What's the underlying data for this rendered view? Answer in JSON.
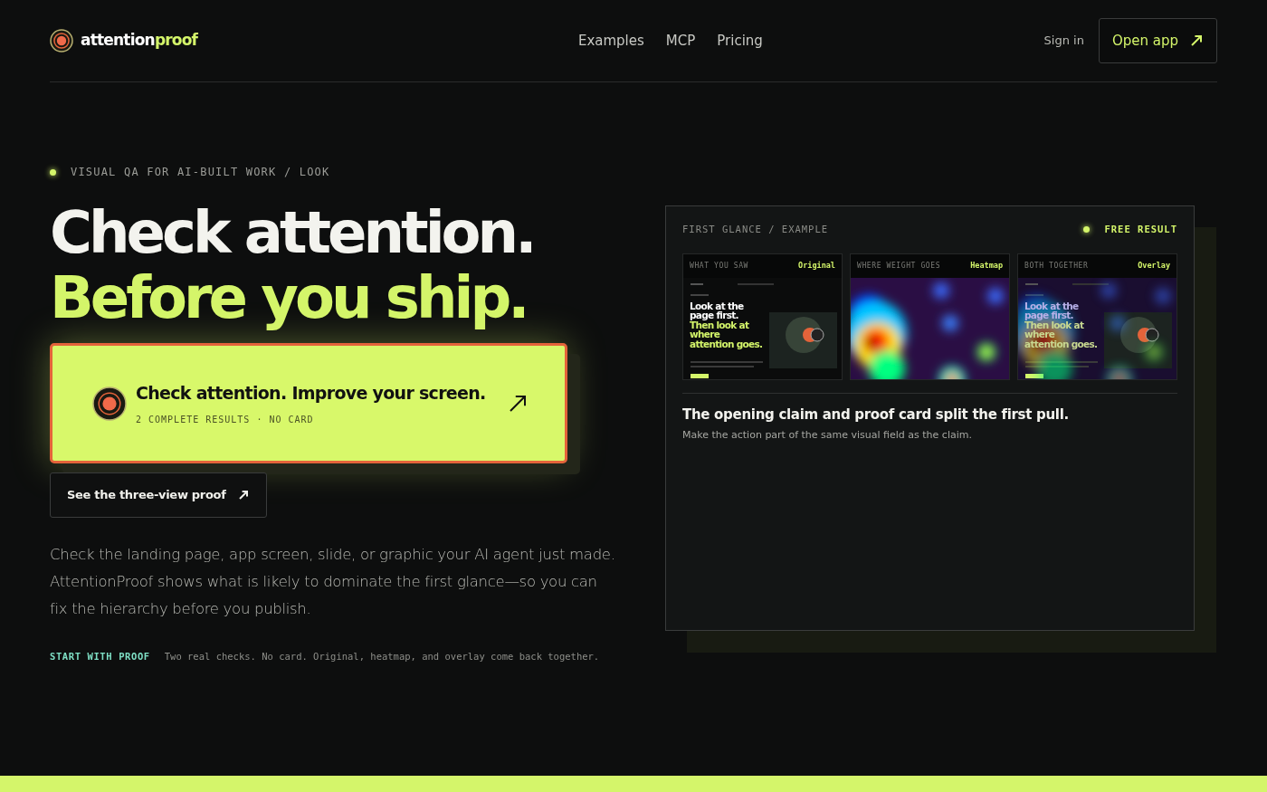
{
  "nav": {
    "brand_main": "attention",
    "brand_accent": "proof",
    "links": [
      "Examples",
      "MCP",
      "Pricing"
    ],
    "sign_in": "Sign in",
    "open_app": "Open app"
  },
  "hero": {
    "eyebrow": "VISUAL QA FOR AI-BUILT WORK / LOOK",
    "headline_1": "Check attention.",
    "headline_2": "Before you ship.",
    "cta": {
      "title": "Check attention. Improve your screen.",
      "subtitle": "2 COMPLETE RESULTS · NO CARD"
    },
    "secondary": "See the three-view proof",
    "body": "Check the landing page, app screen, slide, or graphic your AI agent just made. AttentionProof shows what is likely to dominate the first glance—so you can fix the hierarchy before you publish.",
    "footnote_label": "START WITH PROOF",
    "footnote_text": "Two real checks. No card. Original, heatmap, and overlay come back together."
  },
  "example": {
    "label": "FIRST GLANCE / EXAMPLE",
    "badge": "FREE RESULT",
    "panels": [
      {
        "caption": "WHAT YOU SAW",
        "tag": "Original",
        "kind": "original",
        "line_white": "Look at the page first.",
        "line_green": "Then look at where attention goes."
      },
      {
        "caption": "WHERE WEIGHT GOES",
        "tag": "Heatmap",
        "kind": "heatmap"
      },
      {
        "caption": "BOTH TOGETHER",
        "tag": "Overlay",
        "kind": "overlay",
        "line_white": "Look at the page first.",
        "line_green": "Then look at where attention goes."
      }
    ],
    "claim": "The opening claim and proof card split the first pull.",
    "note": "Make the action part of the same visual field as the claim."
  }
}
